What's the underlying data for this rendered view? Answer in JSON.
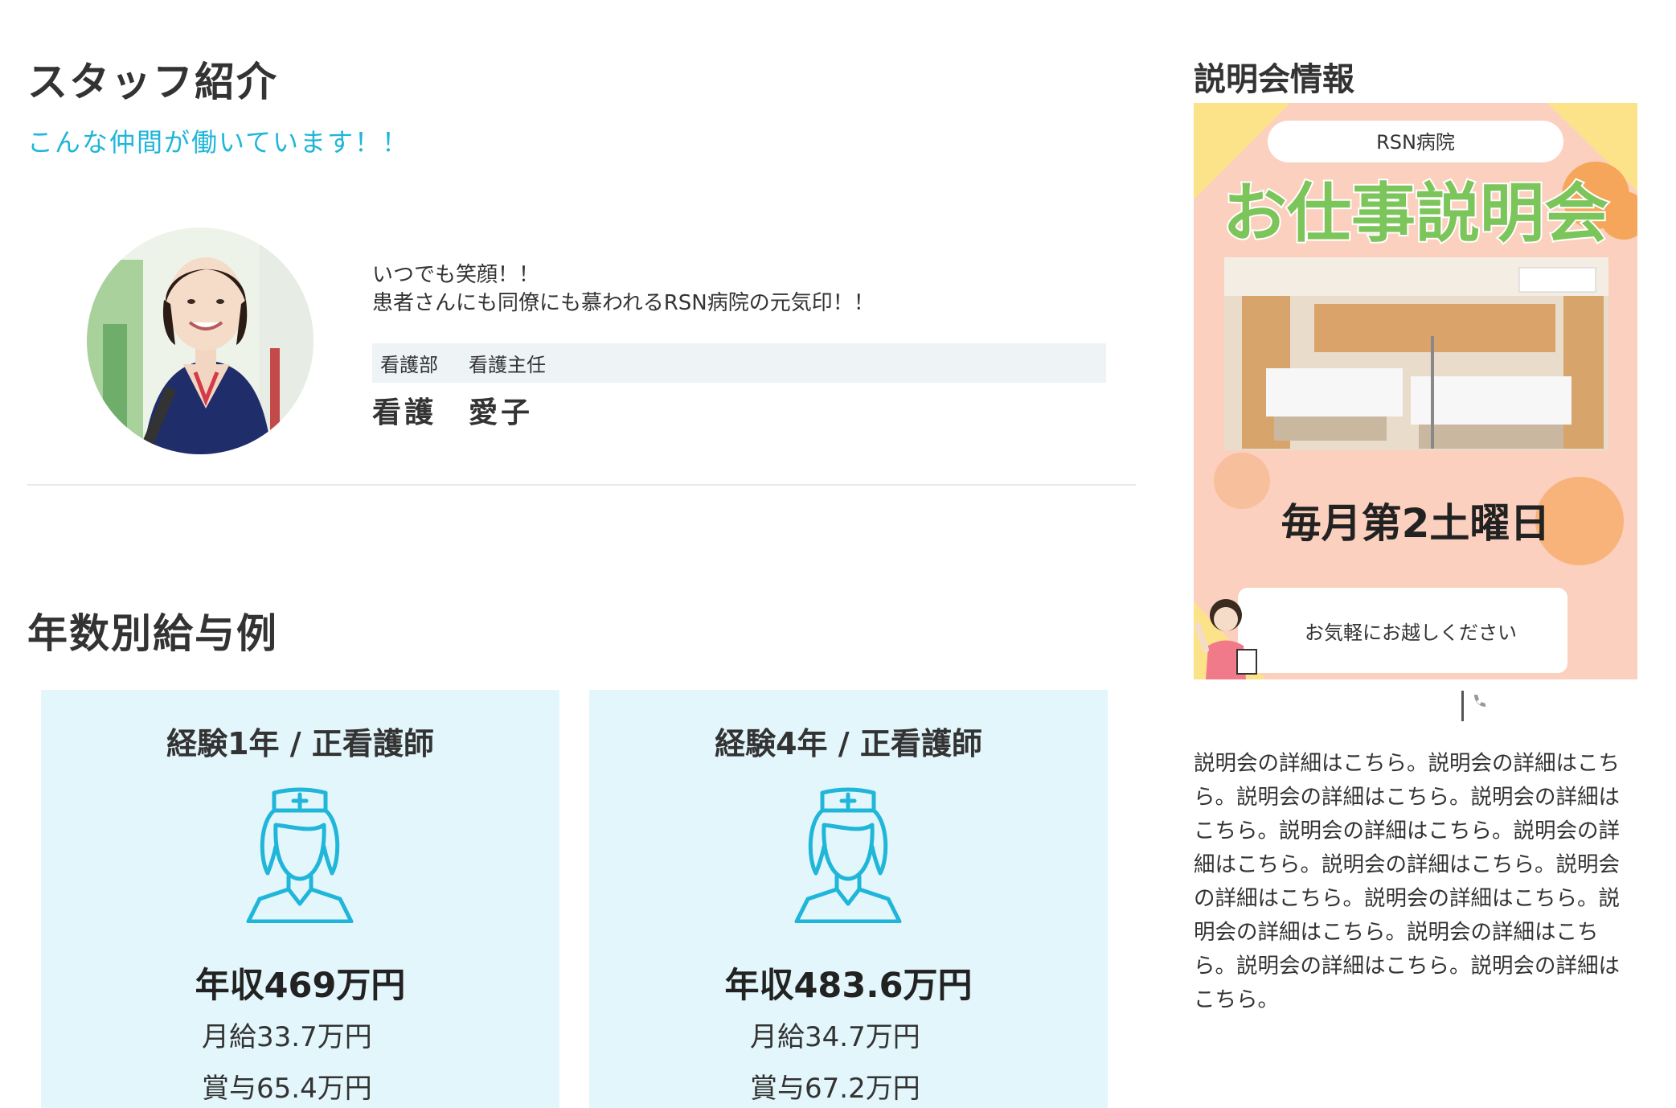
{
  "staff": {
    "title": "スタッフ紹介",
    "subtitle": "こんな仲間が働いています！！",
    "message_line1": "いつでも笑顔！！",
    "message_line2": "患者さんにも同僚にも慕われるRSN病院の元気印！！",
    "department": "看護部",
    "position": "看護主任",
    "name": "看護　愛子"
  },
  "salary": {
    "title": "年数別給与例",
    "cards": [
      {
        "title": "経験1年 / 正看護師",
        "annual": "年収469万円",
        "monthly": "月給33.7万円",
        "bonus": "賞与65.4万円"
      },
      {
        "title": "経験4年 / 正看護師",
        "annual": "年収483.6万円",
        "monthly": "月給34.7万円",
        "bonus": "賞与67.2万円"
      }
    ]
  },
  "sidebar": {
    "title": "説明会情報",
    "flyer": {
      "hospital": "RSN病院",
      "headline": "お仕事説明会",
      "schedule": "毎月第2土曜日",
      "message": "お気軽にお越しください"
    },
    "description": "説明会の詳細はこちら。説明会の詳細はこちら。説明会の詳細はこちら。説明会の詳細はこちら。説明会の詳細はこちら。説明会の詳細はこちら。説明会の詳細はこちら。説明会の詳細はこちら。説明会の詳細はこちら。説明会の詳細はこちら。説明会の詳細はこちら。説明会の詳細はこちら。説明会の詳細はこちら。"
  },
  "colors": {
    "accent": "#1fb6d9",
    "card_bg": "#e3f6fb",
    "flyer_bg": "#fbd0bf",
    "headline_green": "#7cc55a",
    "headline_pink": "#f08fb7"
  }
}
